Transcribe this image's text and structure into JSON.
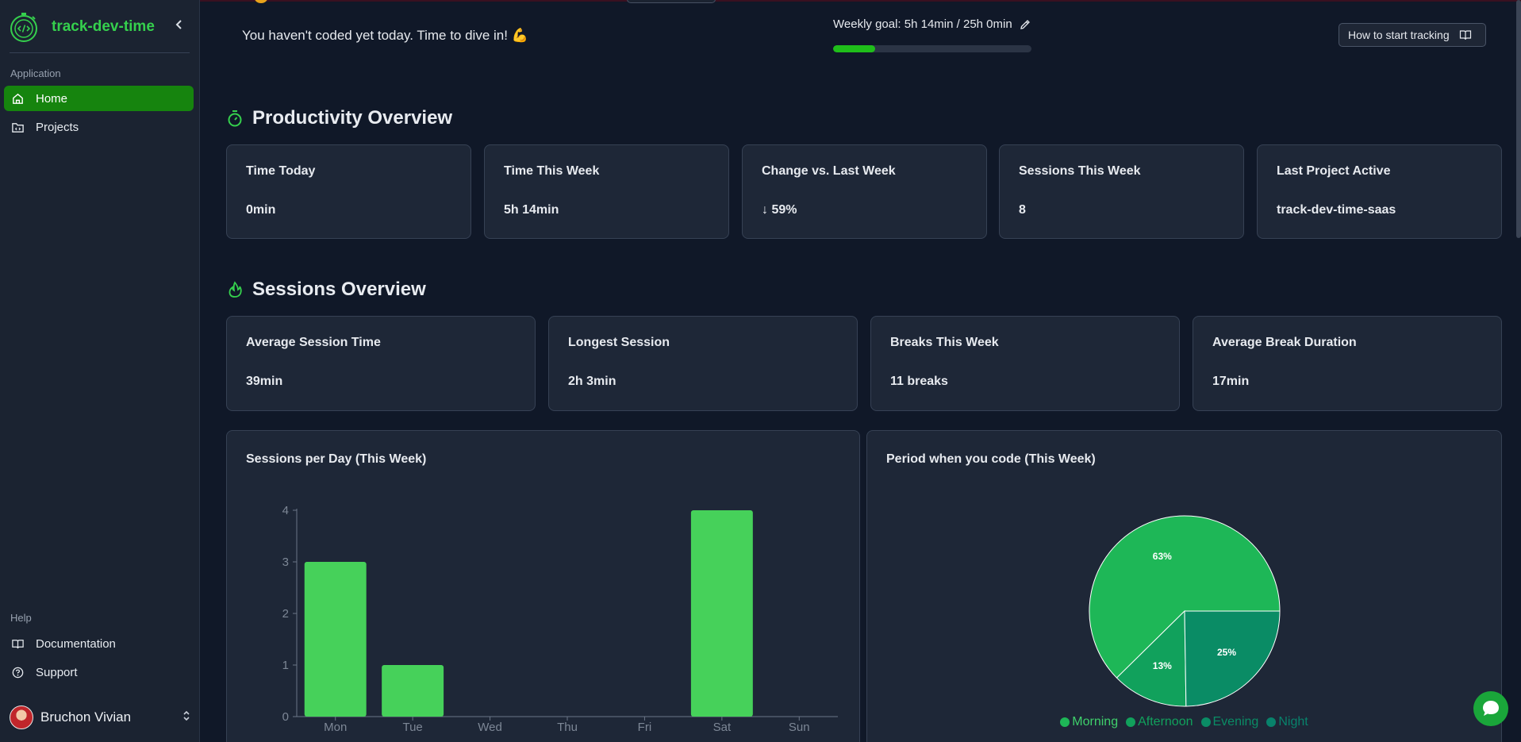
{
  "app": {
    "name": "track-dev-time"
  },
  "sidebar": {
    "application_label": "Application",
    "items": [
      {
        "label": "Home",
        "icon": "home-icon",
        "active": true
      },
      {
        "label": "Projects",
        "icon": "folder-icon",
        "active": false
      }
    ],
    "help_label": "Help",
    "help_items": [
      {
        "label": "Documentation",
        "icon": "book-icon"
      },
      {
        "label": "Support",
        "icon": "help-circle-icon"
      }
    ],
    "user": {
      "name": "Bruchon Vivian"
    }
  },
  "header": {
    "greeting": "You haven't coded yet today. Time to dive in! 💪",
    "weekly_goal": "Weekly goal: 5h 14min / 25h 0min",
    "weekly_goal_progress": 0.21,
    "how_button": "How to start tracking"
  },
  "productivity": {
    "title": "Productivity Overview",
    "cards": [
      {
        "title": "Time Today",
        "value": "0min"
      },
      {
        "title": "Time This Week",
        "value": "5h 14min"
      },
      {
        "title": "Change vs. Last Week",
        "value": "↓ 59%"
      },
      {
        "title": "Sessions This Week",
        "value": "8"
      },
      {
        "title": "Last Project Active",
        "value": "track-dev-time-saas"
      }
    ]
  },
  "sessions": {
    "title": "Sessions Overview",
    "cards": [
      {
        "title": "Average Session Time",
        "value": "39min"
      },
      {
        "title": "Longest Session",
        "value": "2h 3min"
      },
      {
        "title": "Breaks This Week",
        "value": "11 breaks"
      },
      {
        "title": "Average Break Duration",
        "value": "17min"
      }
    ]
  },
  "colors": {
    "accent": "#35d04d",
    "bar": "#46d15a",
    "morning": "#1eb757",
    "afternoon": "#11a15c",
    "evening": "#0a8c65",
    "night": "#08826b"
  },
  "chart_data": [
    {
      "type": "bar",
      "title": "Sessions per Day (This Week)",
      "categories": [
        "Mon",
        "Tue",
        "Wed",
        "Thu",
        "Fri",
        "Sat",
        "Sun"
      ],
      "values": [
        3,
        1,
        0,
        0,
        0,
        4,
        0
      ],
      "ylim": [
        0,
        4
      ],
      "yticks": [
        0,
        1,
        2,
        3,
        4
      ],
      "xlabel": "",
      "ylabel": ""
    },
    {
      "type": "pie",
      "title": "Period when you code (This Week)",
      "labels": [
        "Morning",
        "Afternoon",
        "Evening",
        "Night"
      ],
      "values": [
        63,
        13,
        25,
        0
      ],
      "slice_labels": [
        "63%",
        "13%",
        "25%",
        ""
      ],
      "legend": "bottom"
    }
  ]
}
